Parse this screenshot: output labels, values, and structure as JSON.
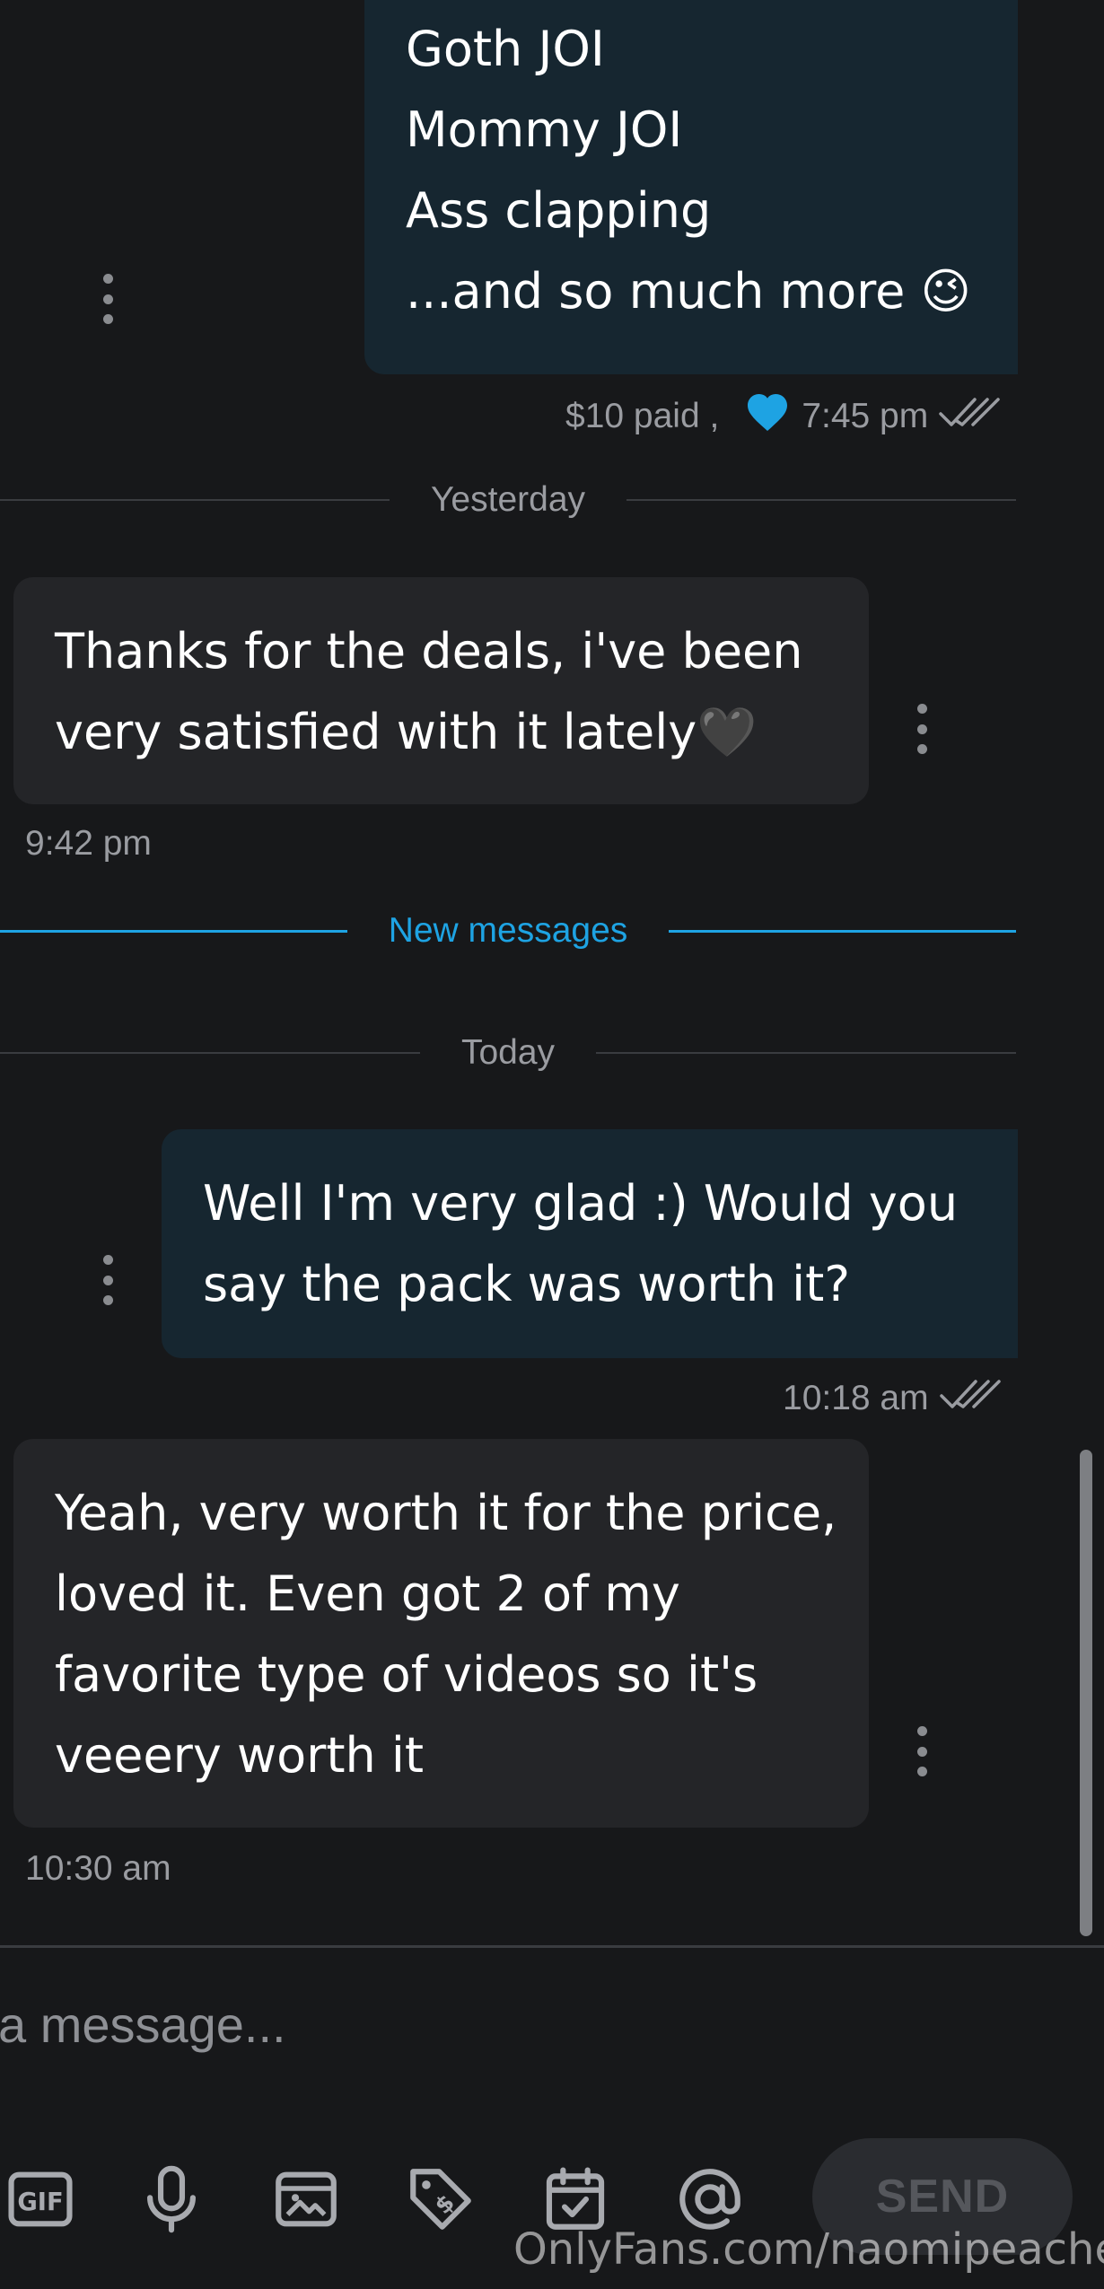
{
  "messages": [
    {
      "direction": "out",
      "lines": [
        "Goth JOI",
        "Mommy JOI",
        "Ass clapping",
        "...and so much more 😉"
      ],
      "meta": {
        "paid": "$10 paid ,",
        "time": "7:45 pm"
      }
    },
    {
      "direction": "in",
      "lines": [
        "Thanks for the deals, i've been",
        "very satisfied with it lately🖤"
      ],
      "meta": {
        "time": "9:42 pm"
      }
    },
    {
      "direction": "out",
      "lines": [
        "Well I'm very glad :) Would you",
        "say the pack was worth it?"
      ],
      "meta": {
        "time": "10:18 am"
      }
    },
    {
      "direction": "in",
      "lines": [
        "Yeah, very worth it for the price,",
        "loved it. Even got 2 of my",
        "favorite type of videos so it's",
        "veeery worth it"
      ],
      "meta": {
        "time": "10:30 am"
      }
    }
  ],
  "dividers": {
    "yesterday": "Yesterday",
    "new_messages": "New messages",
    "today": "Today"
  },
  "composer": {
    "placeholder": "a message...",
    "send_label": "SEND"
  },
  "toolbar_icons": [
    "gif-icon",
    "microphone-icon",
    "image-icon",
    "price-tag-icon",
    "calendar-check-icon",
    "mention-icon"
  ],
  "watermark": "OnlyFans.com/naomipeaches",
  "colors": {
    "background": "#17181a",
    "outgoing_bubble": "#162630",
    "incoming_bubble": "#242528",
    "accent": "#1ea3e3",
    "heart": "#1ea3e3"
  }
}
